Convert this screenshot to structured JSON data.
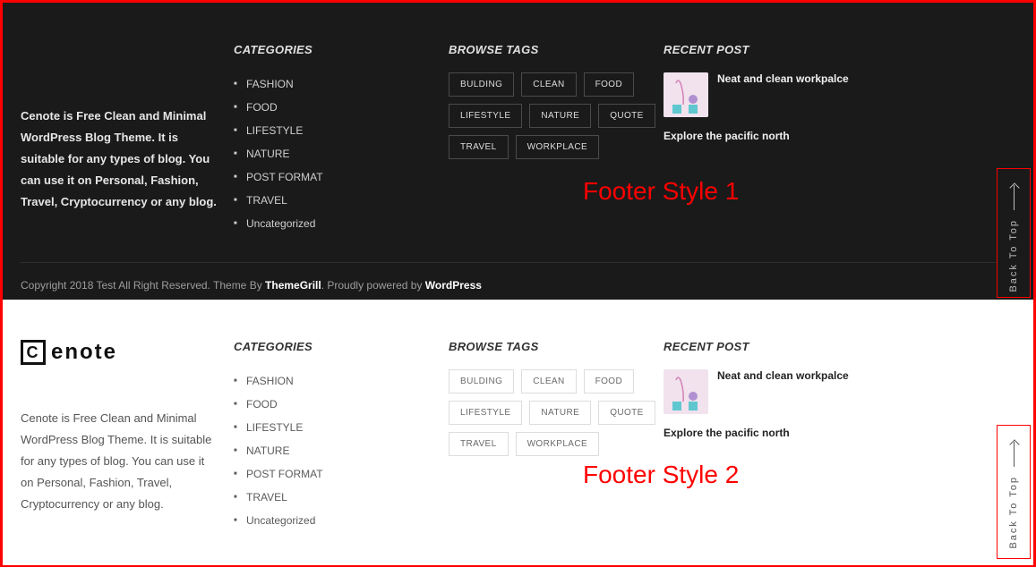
{
  "about_text": "Cenote is Free Clean and Minimal WordPress Blog Theme. It is suitable for any types of blog. You can use it on Personal, Fashion, Travel, Cryptocurrency  or any blog.",
  "headings": {
    "categories": "CATEGORIES",
    "tags": "BROWSE TAGS",
    "recent": "RECENT POST"
  },
  "categories": [
    "FASHION",
    "FOOD",
    "LIFESTYLE",
    "NATURE",
    "POST FORMAT",
    "TRAVEL",
    "Uncategorized"
  ],
  "tags": [
    "BULDING",
    "CLEAN",
    "FOOD",
    "LIFESTYLE",
    "NATURE",
    "QUOTE",
    "TRAVEL",
    "WORKPLACE"
  ],
  "posts": {
    "p1": "Neat and clean workpalce",
    "p2": "Explore the pacific north"
  },
  "copyright": {
    "t1": "Copyright 2018 Test All Right Reserved. Theme By ",
    "l1": "ThemeGrill",
    "t2": ". Proudly powered by ",
    "l2": "WordPress"
  },
  "annotations": {
    "a1": "Footer Style 1",
    "a2": "Footer Style 2"
  },
  "back_to_top": "Back To Top",
  "logo": {
    "letter": "C",
    "rest": "enote"
  }
}
